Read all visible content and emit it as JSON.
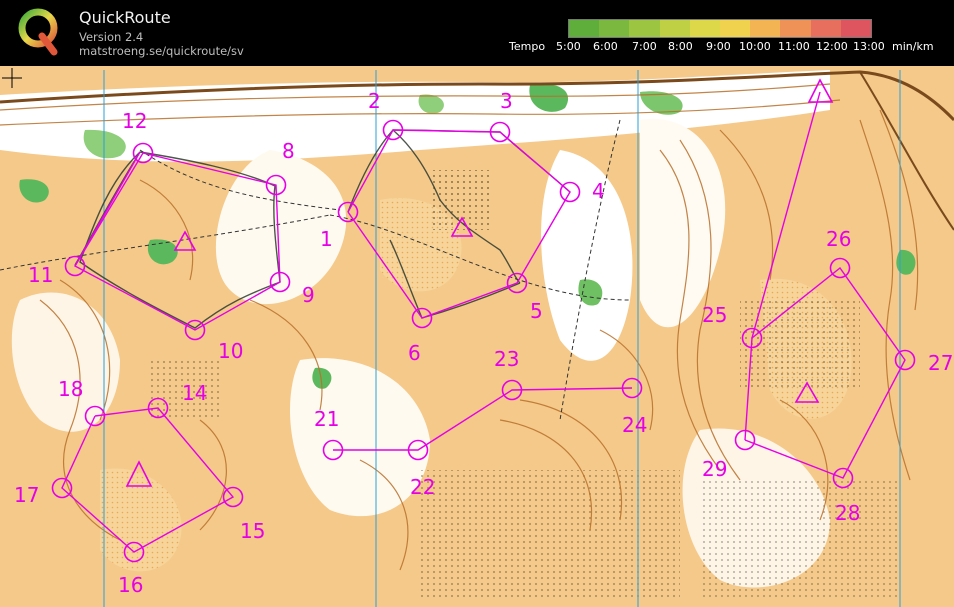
{
  "app": {
    "title": "QuickRoute",
    "version": "Version 2.4",
    "url": "matstroeng.se/quickroute/sv"
  },
  "legend": {
    "title": "Tempo",
    "ticks": [
      "5:00",
      "6:00",
      "7:00",
      "8:00",
      "9:00",
      "10:00",
      "11:00",
      "12:00",
      "13:00"
    ],
    "unit": "min/km",
    "colors": [
      "#5fae3c",
      "#7ab83f",
      "#9cc642",
      "#bfd045",
      "#ddd84a",
      "#f0d24e",
      "#f3b553",
      "#ee9257",
      "#e6705d",
      "#de5560"
    ]
  },
  "map": {
    "colors": {
      "paper": "#ffffff",
      "open_land": "#f5c98a",
      "forest_green": "#5cb85c",
      "contour": "#b8702a",
      "course": "#e600e6",
      "north_lines": "#2aa0d8",
      "route": "#333333"
    },
    "start_label": "start-triangle",
    "controls": [
      {
        "n": "1"
      },
      {
        "n": "2"
      },
      {
        "n": "3"
      },
      {
        "n": "4"
      },
      {
        "n": "5"
      },
      {
        "n": "6"
      },
      {
        "n": "8"
      },
      {
        "n": "9"
      },
      {
        "n": "10"
      },
      {
        "n": "11"
      },
      {
        "n": "12"
      },
      {
        "n": "14"
      },
      {
        "n": "15"
      },
      {
        "n": "16"
      },
      {
        "n": "17"
      },
      {
        "n": "18"
      },
      {
        "n": "21"
      },
      {
        "n": "22"
      },
      {
        "n": "23"
      },
      {
        "n": "24"
      },
      {
        "n": "25"
      },
      {
        "n": "26"
      },
      {
        "n": "27"
      },
      {
        "n": "28"
      },
      {
        "n": "29"
      }
    ]
  }
}
